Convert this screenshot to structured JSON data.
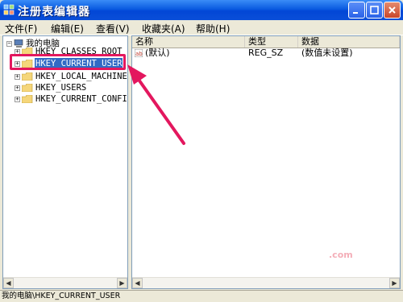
{
  "window": {
    "title": "注册表编辑器",
    "minimize_label": "_",
    "maximize_label": "□",
    "close_label": "✕"
  },
  "menu": {
    "items": [
      "文件(F)",
      "编辑(E)",
      "查看(V)",
      "收藏夹(A)",
      "帮助(H)"
    ]
  },
  "tree": {
    "root_label": "我的电脑",
    "expander_symbol": "+",
    "collapse_symbol": "−",
    "items": [
      {
        "label": "HKEY_CLASSES_ROOT"
      },
      {
        "label": "HKEY_CURRENT_USER",
        "selected": true
      },
      {
        "label": "HKEY_LOCAL_MACHINE"
      },
      {
        "label": "HKEY_USERS"
      },
      {
        "label": "HKEY_CURRENT_CONFIG"
      }
    ]
  },
  "list": {
    "columns": [
      "名称",
      "类型",
      "数据"
    ],
    "rows": [
      {
        "name": "(默认)",
        "type": "REG_SZ",
        "data": "(数值未设置)"
      }
    ]
  },
  "statusbar": {
    "path": "我的电脑\\HKEY_CURRENT_USER"
  },
  "watermark": ".com",
  "colors": {
    "highlight": "#e3175e",
    "selection": "#316ac5",
    "titlebar": "#0a5be0"
  },
  "icons": {
    "app": "registry-icon",
    "folder": "folder-icon",
    "computer": "computer-icon",
    "value": "string-value-icon"
  }
}
